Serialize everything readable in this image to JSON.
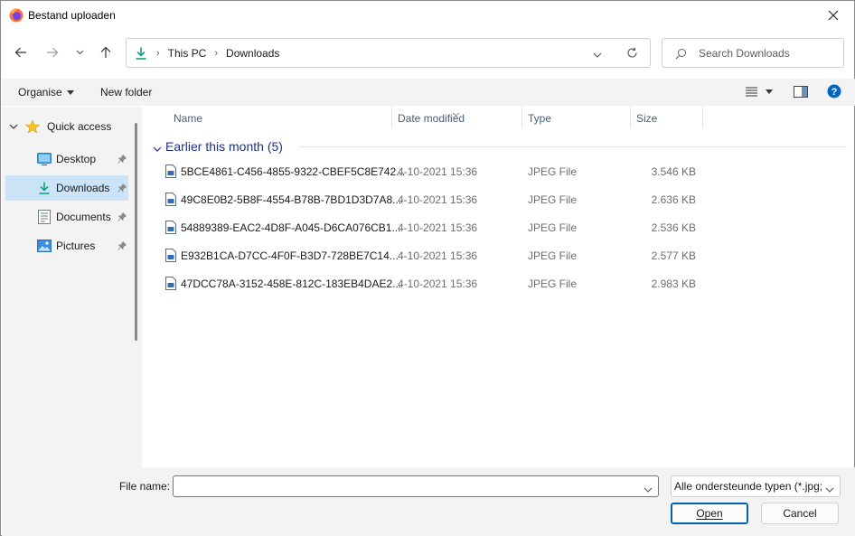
{
  "window": {
    "title": "Bestand uploaden"
  },
  "nav": {
    "breadcrumb": [
      "This PC",
      "Downloads"
    ],
    "search_placeholder": "Search Downloads"
  },
  "toolbar": {
    "organise_label": "Organise",
    "new_folder_label": "New folder"
  },
  "sidebar": {
    "quick_access_label": "Quick access",
    "items": [
      {
        "label": "Desktop",
        "icon": "desktop-icon",
        "pinned": true
      },
      {
        "label": "Downloads",
        "icon": "download-icon",
        "pinned": true,
        "selected": true
      },
      {
        "label": "Documents",
        "icon": "document-icon",
        "pinned": true
      },
      {
        "label": "Pictures",
        "icon": "pictures-icon",
        "pinned": true
      }
    ]
  },
  "columns": {
    "name": "Name",
    "date": "Date modified",
    "type": "Type",
    "size": "Size"
  },
  "group": {
    "label": "Earlier this month (5)"
  },
  "files": [
    {
      "name": "5BCE4861-C456-4855-9322-CBEF5C8E742...",
      "date": "4-10-2021 15:36",
      "type": "JPEG File",
      "size": "3.546 KB"
    },
    {
      "name": "49C8E0B2-5B8F-4554-B78B-7BD1D3D7A8...",
      "date": "4-10-2021 15:36",
      "type": "JPEG File",
      "size": "2.636 KB"
    },
    {
      "name": "54889389-EAC2-4D8F-A045-D6CA076CB1...",
      "date": "4-10-2021 15:36",
      "type": "JPEG File",
      "size": "2.536 KB"
    },
    {
      "name": "E932B1CA-D7CC-4F0F-B3D7-728BE7C14...",
      "date": "4-10-2021 15:36",
      "type": "JPEG File",
      "size": "2.577 KB"
    },
    {
      "name": "47DCC78A-3152-458E-812C-183EB4DAE2...",
      "date": "4-10-2021 15:36",
      "type": "JPEG File",
      "size": "2.983 KB"
    }
  ],
  "footer": {
    "file_name_label": "File name:",
    "file_name_value": "",
    "file_type": "Alle ondersteunde typen (*.jpg;",
    "open_label": "Open",
    "cancel_label": "Cancel"
  },
  "colors": {
    "accent": "#005fb8",
    "selected_bg": "#cce4f7",
    "group_text": "#1e3287",
    "help_blue": "#0067c0"
  }
}
